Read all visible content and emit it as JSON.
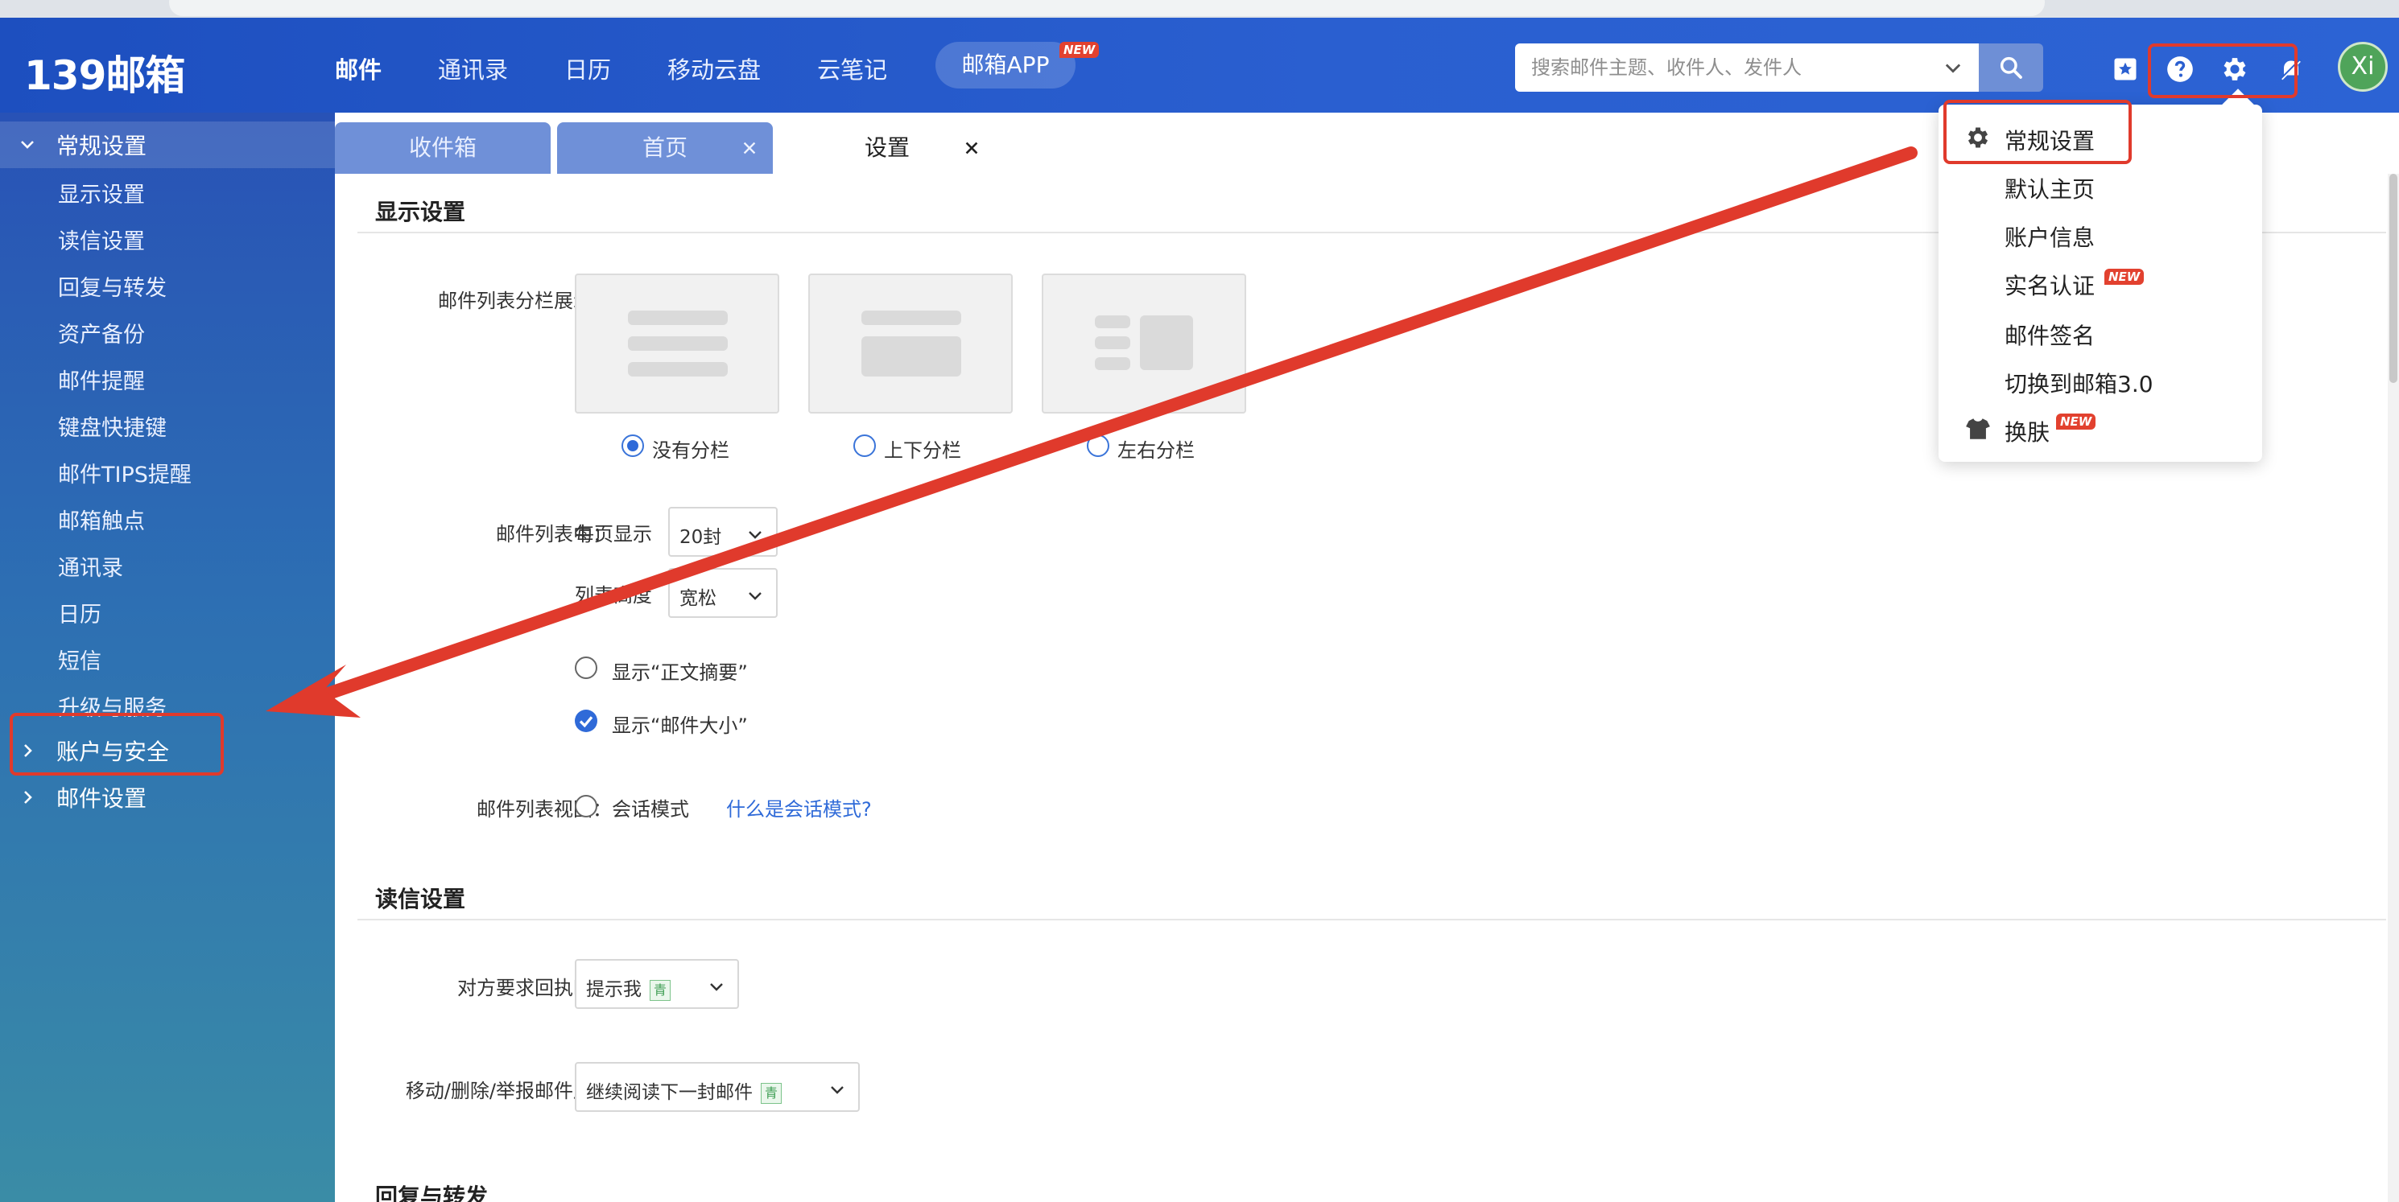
{
  "app": {
    "logo_text": "139邮箱",
    "user_initials": "Xi"
  },
  "nav": {
    "items": [
      "邮件",
      "通讯录",
      "日历",
      "移动云盘",
      "云笔记"
    ],
    "app_button": "邮箱APP",
    "app_badge": "NEW"
  },
  "search": {
    "placeholder": "搜索邮件主题、收件人、发件人"
  },
  "sidebar": {
    "general_section": "常规设置",
    "items": [
      "显示设置",
      "读信设置",
      "回复与转发",
      "资产备份",
      "邮件提醒",
      "键盘快捷键",
      "邮件TIPS提醒",
      "邮箱触点",
      "通讯录",
      "日历",
      "短信",
      "升级与服务"
    ],
    "account_section": "账户与安全",
    "mail_section": "邮件设置"
  },
  "tabs": [
    {
      "label": "收件箱"
    },
    {
      "label": "首页"
    },
    {
      "label": "设置"
    }
  ],
  "display": {
    "title": "显示设置",
    "split_label": "邮件列表分栏展示：",
    "split_options": [
      "没有分栏",
      "上下分栏",
      "左右分栏"
    ],
    "list_label": "邮件列表中：",
    "per_page_label": "每页显示",
    "per_page_value": "20封",
    "row_height_label": "列表高度",
    "row_height_value": "宽松",
    "show_summary": "显示“正文摘要”",
    "show_size": "显示“邮件大小”",
    "view_label": "邮件列表视图：",
    "view_option": "会话模式",
    "view_help_link": "什么是会话模式?"
  },
  "reading": {
    "title": "读信设置",
    "receipt_label": "对方要求回执时：",
    "receipt_value": "提示我",
    "after_move_label": "移动/删除/举报邮件后：",
    "after_move_value": "继续阅读下一封邮件",
    "vip_tag": "青"
  },
  "reply": {
    "title": "回复与转发"
  },
  "dropdown": {
    "items": [
      "常规设置",
      "默认主页",
      "账户信息",
      "实名认证",
      "邮件签名",
      "切换到邮箱3.0",
      "换肤"
    ],
    "badge": "NEW"
  },
  "colors": {
    "header": "#2a5fd0",
    "annotation": "#e03a2c",
    "accent": "#2f6ad8"
  }
}
